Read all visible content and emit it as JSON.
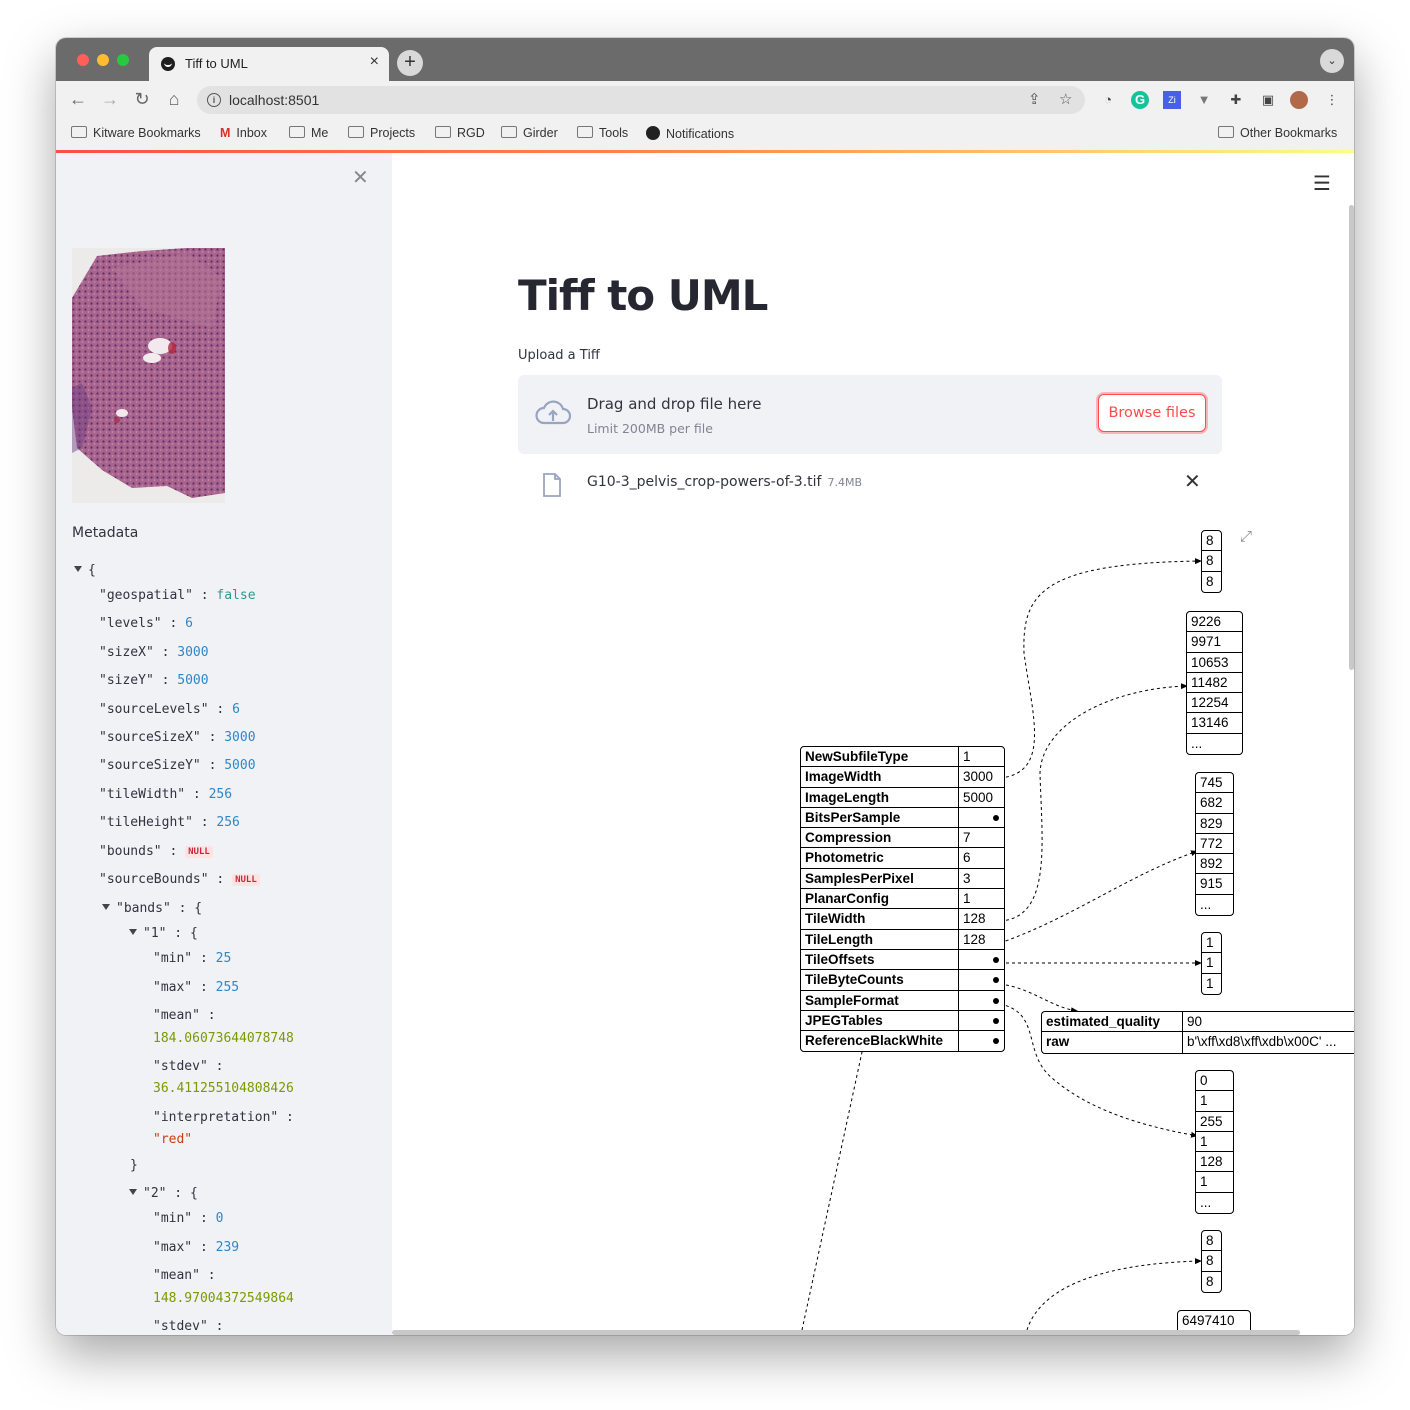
{
  "browser": {
    "tab_title": "Tiff to UML",
    "url": "localhost:8501",
    "bookmarks": [
      "Kitware Bookmarks",
      "Inbox",
      "Me",
      "Projects",
      "RGD",
      "Girder",
      "Tools",
      "Notifications"
    ],
    "other_bookmarks": "Other Bookmarks"
  },
  "sidebar": {
    "metadata_label": "Metadata",
    "json": {
      "geospatial": "false",
      "levels": "6",
      "sizeX": "3000",
      "sizeY": "5000",
      "sourceLevels": "6",
      "sourceSizeX": "3000",
      "sourceSizeY": "5000",
      "tileWidth": "256",
      "tileHeight": "256",
      "bounds": "NULL",
      "sourceBounds": "NULL",
      "band1": {
        "min": "25",
        "max": "255",
        "mean": "184.06073644078748",
        "stdev": "36.411255104808426",
        "interpretation": "\"red\""
      },
      "band2": {
        "min": "0",
        "max": "239",
        "mean": "148.97004372549864"
      }
    }
  },
  "main": {
    "title": "Tiff to UML",
    "upload_label": "Upload a Tiff",
    "dropzone_text": "Drag and drop file here",
    "dropzone_limit": "Limit 200MB per file",
    "browse_label": "Browse files",
    "file_name": "G10-3_pelvis_crop-powers-of-3.tif",
    "file_size": "7.4MB"
  },
  "diagram": {
    "ifd": [
      {
        "key": "NewSubfileType",
        "value": "1"
      },
      {
        "key": "ImageWidth",
        "value": "3000"
      },
      {
        "key": "ImageLength",
        "value": "5000"
      },
      {
        "key": "BitsPerSample",
        "value": ""
      },
      {
        "key": "Compression",
        "value": "7"
      },
      {
        "key": "Photometric",
        "value": "6"
      },
      {
        "key": "SamplesPerPixel",
        "value": "3"
      },
      {
        "key": "PlanarConfig",
        "value": "1"
      },
      {
        "key": "TileWidth",
        "value": "128"
      },
      {
        "key": "TileLength",
        "value": "128"
      },
      {
        "key": "TileOffsets",
        "value": ""
      },
      {
        "key": "TileByteCounts",
        "value": ""
      },
      {
        "key": "SampleFormat",
        "value": ""
      },
      {
        "key": "JPEGTables",
        "value": ""
      },
      {
        "key": "ReferenceBlackWhite",
        "value": ""
      }
    ],
    "bits_per_sample": [
      "8",
      "8",
      "8"
    ],
    "tile_offsets": [
      "9226",
      "9971",
      "10653",
      "11482",
      "12254",
      "13146",
      "..."
    ],
    "tile_byte_counts": [
      "745",
      "682",
      "829",
      "772",
      "892",
      "915",
      "..."
    ],
    "sample_format": [
      "1",
      "1",
      "1"
    ],
    "jpeg_tables": [
      {
        "key": "estimated_quality",
        "value": "90"
      },
      {
        "key": "raw",
        "value": "b'\\xff\\xd8\\xff\\xdb\\x00C' ..."
      }
    ],
    "reference_black_white": [
      "0",
      "1",
      "255",
      "1",
      "128",
      "1",
      "..."
    ],
    "bits_per_sample_2": [
      "8",
      "8",
      "8"
    ],
    "next_value": "6497410"
  }
}
